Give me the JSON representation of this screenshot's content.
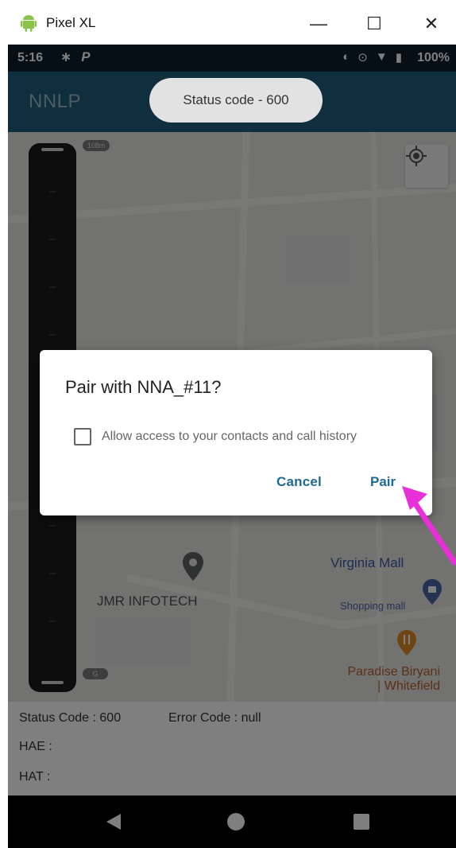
{
  "window": {
    "title": "Pixel XL",
    "minimize": "—",
    "maximize": "☐",
    "close": "✕",
    "icon": "android-icon"
  },
  "status_bar": {
    "time": "5:16",
    "battery": "100%",
    "icons": [
      "bluetooth-icon",
      "parking-icon",
      "vibrate-icon",
      "location-icon",
      "wifi-icon",
      "battery-icon"
    ]
  },
  "app_bar": {
    "title": "NNLP"
  },
  "toast": {
    "text": "Status code - 600"
  },
  "map": {
    "scale_top": "108m",
    "scale_bottom": "G",
    "labels": {
      "jmr": "JMR INFOTECH",
      "virginia": "Virginia Mall",
      "shopping": "Shopping mall",
      "paradise_line1": "Paradise Biryani",
      "paradise_line2": "| Whitefield"
    },
    "locate_icon": "my-location-icon"
  },
  "dialog": {
    "title": "Pair with NNA_#11?",
    "checkbox_label": "Allow access to your contacts and call history",
    "checkbox_checked": false,
    "cancel_label": "Cancel",
    "pair_label": "Pair"
  },
  "info": {
    "status_code": "Status Code : 600",
    "error_code": "Error Code : null",
    "hae": "HAE :",
    "hat": "HAT :"
  },
  "nav": {
    "back": "back-icon",
    "home": "home-icon",
    "recent": "recent-apps-icon"
  },
  "colors": {
    "app_bar": "#1e5d7c",
    "status_bar": "#0b1f2a",
    "accent": "#1e6a93",
    "arrow": "#e82fd8"
  }
}
